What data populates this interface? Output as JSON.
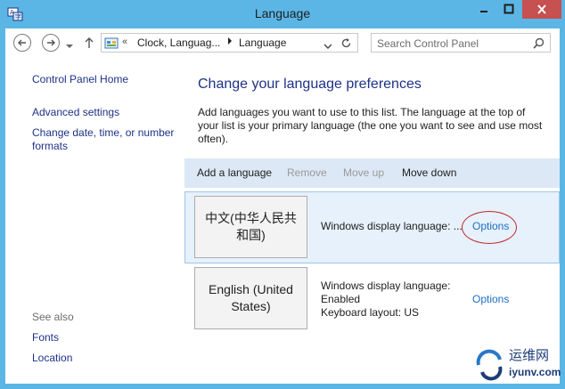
{
  "window": {
    "title": "Language",
    "controls": [
      "minimize",
      "maximize",
      "close"
    ],
    "chrome_color": "#5bb6e6",
    "close_color": "#c75050"
  },
  "nav": {
    "back_icon": "back-arrow-icon",
    "forward_icon": "forward-arrow-icon",
    "up_icon": "up-arrow-icon",
    "address_overflow": "«",
    "address_segments": [
      "Clock, Languag...",
      "Language"
    ],
    "search_placeholder": "Search Control Panel"
  },
  "sidebar": {
    "home": "Control Panel Home",
    "links": [
      "Advanced settings",
      "Change date, time, or number formats"
    ],
    "see_also_label": "See also",
    "see_also": [
      "Fonts",
      "Location"
    ]
  },
  "main": {
    "heading": "Change your language preferences",
    "description": "Add languages you want to use to this list. The language at the top of your list is your primary language (the one you want to see and use most often).",
    "toolbar": {
      "add": "Add a language",
      "remove": "Remove",
      "move_up": "Move up",
      "move_down": "Move down"
    },
    "languages": [
      {
        "name": "中文(中华人民共和国)",
        "info": "Windows display language: ...",
        "options": "Options",
        "selected": true
      },
      {
        "name": "English (United States)",
        "info_line1": "Windows display language:",
        "info_line2": "Enabled",
        "info_line3": "Keyboard layout: US",
        "options": "Options",
        "selected": false
      }
    ],
    "link_color": "#1e3287",
    "options_color": "#1e6fc1",
    "annotation_color": "#c4282e"
  },
  "watermark": {
    "text": "运维网",
    "url": "iyunv.com"
  }
}
